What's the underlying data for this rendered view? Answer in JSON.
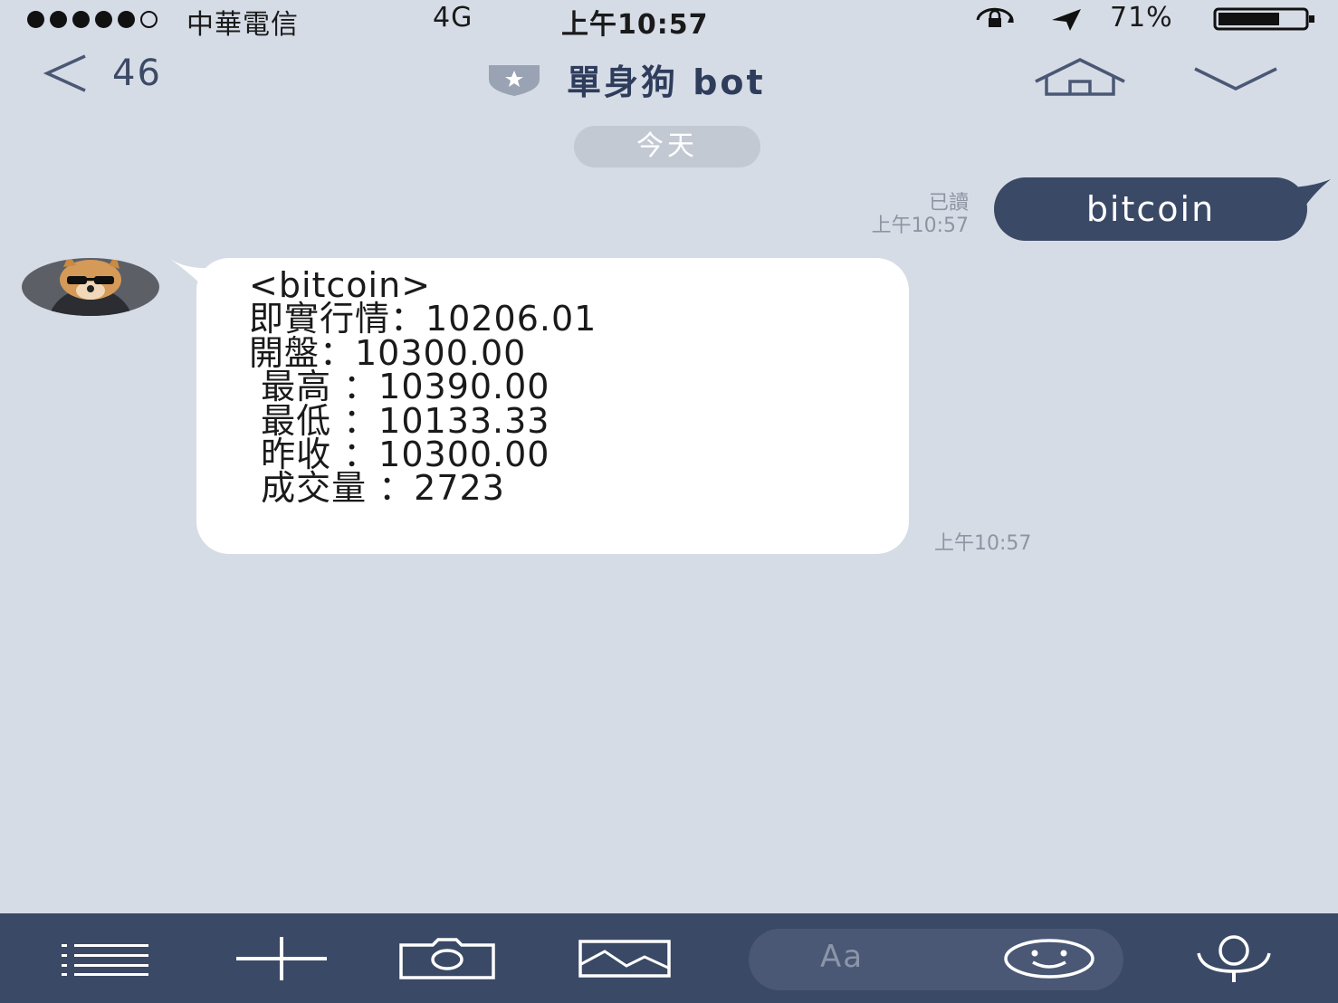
{
  "status_bar": {
    "carrier": "中華電信",
    "network": "4G",
    "time": "上午10:57",
    "battery": "71%",
    "battery_level": 0.71
  },
  "nav": {
    "back_count": "46",
    "title": "單身狗 bot"
  },
  "chat": {
    "date_separator": "今天",
    "outgoing": {
      "read_label": "已讀",
      "time": "上午10:57",
      "text": "bitcoin"
    },
    "incoming": {
      "lines": [
        "<bitcoin>",
        "即實行情：10206.01",
        "開盤：10300.00",
        " 最高 ：10390.00",
        " 最低 ：10133.33",
        " 昨收 ：10300.00",
        " 成交量 ：2723"
      ],
      "time": "上午10:57"
    }
  },
  "toolbar": {
    "input_placeholder": "Aa"
  },
  "colors": {
    "background": "#d6dce6",
    "accent": "#3a4966",
    "bubble_incoming": "#ffffff",
    "chip": "#c3c9d3"
  }
}
